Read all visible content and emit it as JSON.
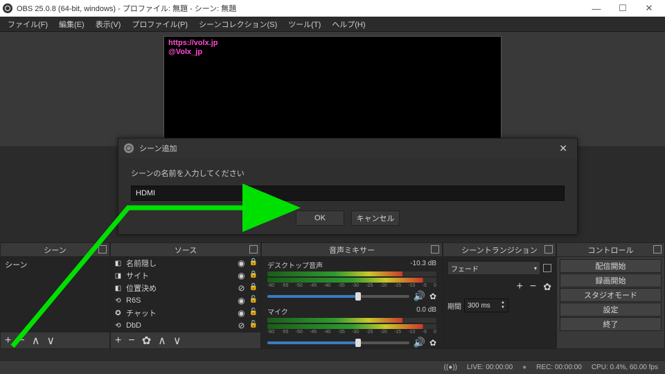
{
  "titlebar": {
    "text": "OBS 25.0.8 (64-bit, windows) - プロファイル: 無題 - シーン: 無題"
  },
  "menu": {
    "file": "ファイル(F)",
    "edit": "編集(E)",
    "view": "表示(V)",
    "profile": "プロファイル(P)",
    "scenecol": "シーンコレクション(S)",
    "tools": "ツール(T)",
    "help": "ヘルプ(H)"
  },
  "preview": {
    "line1": "https://volx.jp",
    "line2": "@Volx_jp"
  },
  "dialog": {
    "title": "シーン追加",
    "prompt": "シーンの名前を入力してください",
    "value": "HDMI",
    "ok": "OK",
    "cancel": "キャンセル"
  },
  "docks": {
    "scenes": "シーン",
    "sources": "ソース",
    "mixer": "音声ミキサー",
    "transitions": "シーントランジション",
    "controls": "コントロール"
  },
  "scenes": {
    "items": [
      "シーン"
    ]
  },
  "sources": {
    "items": [
      {
        "icon": "◧",
        "label": "名前隠し",
        "vis": "◉",
        "lock": "🔒"
      },
      {
        "icon": "◨",
        "label": "サイト",
        "vis": "◉",
        "lock": "🔒"
      },
      {
        "icon": "◧",
        "label": "位置決め",
        "vis": "⊘",
        "lock": "🔒"
      },
      {
        "icon": "⟲",
        "label": "R6S",
        "vis": "◉",
        "lock": "🔓"
      },
      {
        "icon": "✪",
        "label": "チャット",
        "vis": "◉",
        "lock": "🔓"
      },
      {
        "icon": "⟲",
        "label": "DbD",
        "vis": "⊘",
        "lock": "🔓"
      }
    ]
  },
  "mixer": {
    "ch1": {
      "name": "デスクトップ音声",
      "db": "-10.3 dB"
    },
    "ch2": {
      "name": "マイク",
      "db": "0.0 dB"
    },
    "ticks": [
      "-60",
      "-55",
      "-50",
      "-45",
      "-40",
      "-35",
      "-30",
      "-25",
      "-20",
      "-15",
      "-10",
      "-5",
      "0"
    ]
  },
  "transitions": {
    "select": "フェード",
    "durationLabel": "期間",
    "duration": "300 ms"
  },
  "controls": {
    "stream": "配信開始",
    "record": "録画開始",
    "studio": "スタジオモード",
    "settings": "設定",
    "exit": "終了"
  },
  "status": {
    "live": "LIVE: 00:00:00",
    "rec": "REC: 00:00:00",
    "cpu": "CPU: 0.4%, 60.00 fps"
  }
}
